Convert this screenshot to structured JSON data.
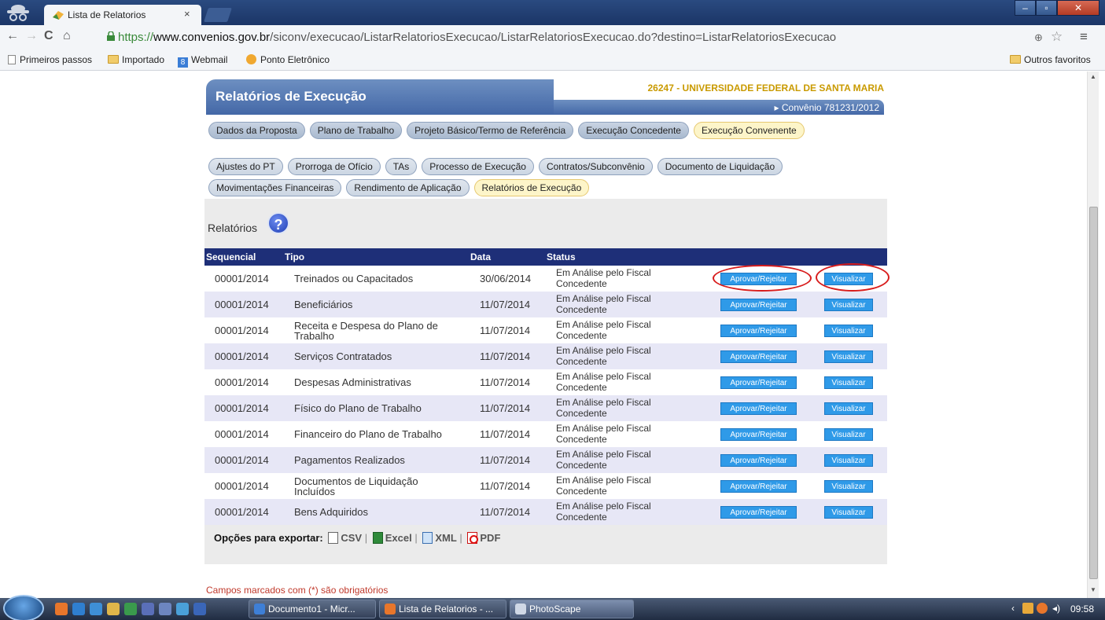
{
  "browser": {
    "tab_title": "Lista de Relatorios",
    "tab_close": "×",
    "url_scheme": "https://",
    "url_host": "www.convenios.gov.br",
    "url_path": "/siconv/execucao/ListarRelatoriosExecucao/ListarRelatoriosExecucao.do?destino=ListarRelatoriosExecucao",
    "bookmarks": [
      "Primeiros passos",
      "Importado",
      "Webmail",
      "Ponto Eletrônico"
    ],
    "other_bookmarks": "Outros favoritos"
  },
  "header": {
    "title": "Relatórios de Execução",
    "org": "26247 - UNIVERSIDADE FEDERAL DE SANTA MARIA",
    "convenio": "Convênio 781231/2012"
  },
  "nav_primary": [
    {
      "label": "Dados da Proposta",
      "active": false
    },
    {
      "label": "Plano de Trabalho",
      "active": false
    },
    {
      "label": "Projeto Básico/Termo de Referência",
      "active": false
    },
    {
      "label": "Execução Concedente",
      "active": false
    },
    {
      "label": "Execução Convenente",
      "active": true
    }
  ],
  "nav_secondary_row1": [
    {
      "label": "Ajustes do PT",
      "active": false
    },
    {
      "label": "Prorroga de Ofício",
      "active": false
    },
    {
      "label": "TAs",
      "active": false
    },
    {
      "label": "Processo de Execução",
      "active": false
    },
    {
      "label": "Contratos/Subconvênio",
      "active": false
    },
    {
      "label": "Documento de Liquidação",
      "active": false
    }
  ],
  "nav_secondary_row2": [
    {
      "label": "Movimentações Financeiras",
      "active": false
    },
    {
      "label": "Rendimento de Aplicação",
      "active": false
    },
    {
      "label": "Relatórios de Execução",
      "active": true
    }
  ],
  "section": {
    "title": "Relatórios",
    "help": "?"
  },
  "table": {
    "headers": {
      "seq": "Sequencial",
      "tipo": "Tipo",
      "data": "Data",
      "status": "Status"
    },
    "approve_label": "Aprovar/Rejeitar",
    "view_label": "Visualizar",
    "rows": [
      {
        "seq": "00001/2014",
        "tipo": "Treinados ou Capacitados",
        "data": "30/06/2014",
        "status": "Em Análise pelo Fiscal Concedente"
      },
      {
        "seq": "00001/2014",
        "tipo": "Beneficiários",
        "data": "11/07/2014",
        "status": "Em Análise pelo Fiscal Concedente"
      },
      {
        "seq": "00001/2014",
        "tipo": "Receita e Despesa do Plano de Trabalho",
        "data": "11/07/2014",
        "status": "Em Análise pelo Fiscal Concedente"
      },
      {
        "seq": "00001/2014",
        "tipo": "Serviços Contratados",
        "data": "11/07/2014",
        "status": "Em Análise pelo Fiscal Concedente"
      },
      {
        "seq": "00001/2014",
        "tipo": "Despesas Administrativas",
        "data": "11/07/2014",
        "status": "Em Análise pelo Fiscal Concedente"
      },
      {
        "seq": "00001/2014",
        "tipo": "Físico do Plano de Trabalho",
        "data": "11/07/2014",
        "status": "Em Análise pelo Fiscal Concedente"
      },
      {
        "seq": "00001/2014",
        "tipo": "Financeiro do Plano de Trabalho",
        "data": "11/07/2014",
        "status": "Em Análise pelo Fiscal Concedente"
      },
      {
        "seq": "00001/2014",
        "tipo": "Pagamentos Realizados",
        "data": "11/07/2014",
        "status": "Em Análise pelo Fiscal Concedente"
      },
      {
        "seq": "00001/2014",
        "tipo": "Documentos de Liquidação Incluídos",
        "data": "11/07/2014",
        "status": "Em Análise pelo Fiscal Concedente"
      },
      {
        "seq": "00001/2014",
        "tipo": "Bens Adquiridos",
        "data": "11/07/2014",
        "status": "Em Análise pelo Fiscal Concedente"
      }
    ]
  },
  "export": {
    "label": "Opções para exportar:",
    "csv": "CSV",
    "excel": "Excel",
    "xml": "XML",
    "pdf": "PDF"
  },
  "footer_note": "Campos marcados com (*) são obrigatórios",
  "taskbar": {
    "tasks": [
      "Documento1 - Micr...",
      "Lista de Relatorios - ...",
      "PhotoScape"
    ],
    "clock": "09:58"
  },
  "colors": {
    "header_blue": "#4468a7",
    "table_header": "#1e2f78",
    "button_blue": "#2f9ae8",
    "annotation_red": "#d81c1c",
    "org_gold": "#c99a00"
  }
}
